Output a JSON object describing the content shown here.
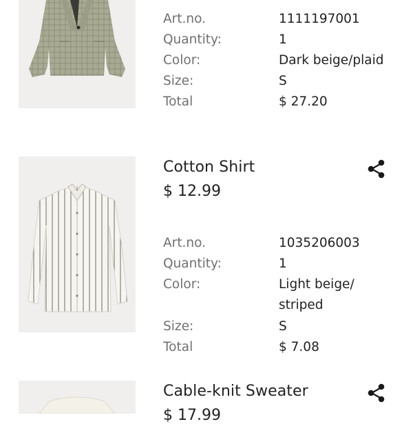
{
  "items": [
    {
      "title": "",
      "price": "",
      "details": [
        {
          "label": "Art.no.",
          "value": "1111197001"
        },
        {
          "label": "Quantity:",
          "value": "1"
        },
        {
          "label": "Color:",
          "value": "Dark beige/plaid"
        },
        {
          "label": "Size:",
          "value": "S"
        },
        {
          "label": "Total",
          "value": "$ 27.20"
        }
      ]
    },
    {
      "title": "Cotton Shirt",
      "price": "$ 12.99",
      "details": [
        {
          "label": "Art.no.",
          "value": "1035206003"
        },
        {
          "label": "Quantity:",
          "value": "1"
        },
        {
          "label": "Color:",
          "value": "Light beige/ striped"
        },
        {
          "label": "Size:",
          "value": "S"
        },
        {
          "label": "Total",
          "value": "$ 7.08"
        }
      ]
    },
    {
      "title": "Cable-knit Sweater",
      "price": "$ 17.99",
      "details": []
    }
  ],
  "icons": {
    "share": "share-icon"
  },
  "colors": {
    "label": "#707070",
    "text": "#222222",
    "image_bg": "#f0efed"
  }
}
